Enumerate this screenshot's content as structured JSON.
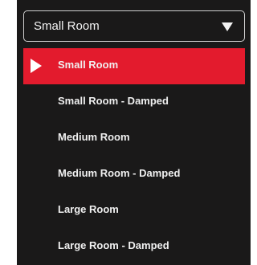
{
  "dropdown": {
    "selected_label": "Small Room"
  },
  "menu": {
    "items": [
      {
        "label": "Small Room",
        "selected": true
      },
      {
        "label": "Small Room - Damped",
        "selected": false
      },
      {
        "label": "Medium Room",
        "selected": false
      },
      {
        "label": "Medium Room - Damped",
        "selected": false
      },
      {
        "label": "Large Room",
        "selected": false
      },
      {
        "label": "Large Room - Damped",
        "selected": false
      }
    ]
  },
  "colors": {
    "background": "#1a1919",
    "highlight": "#e31b2d",
    "text": "#f0f0f0"
  }
}
